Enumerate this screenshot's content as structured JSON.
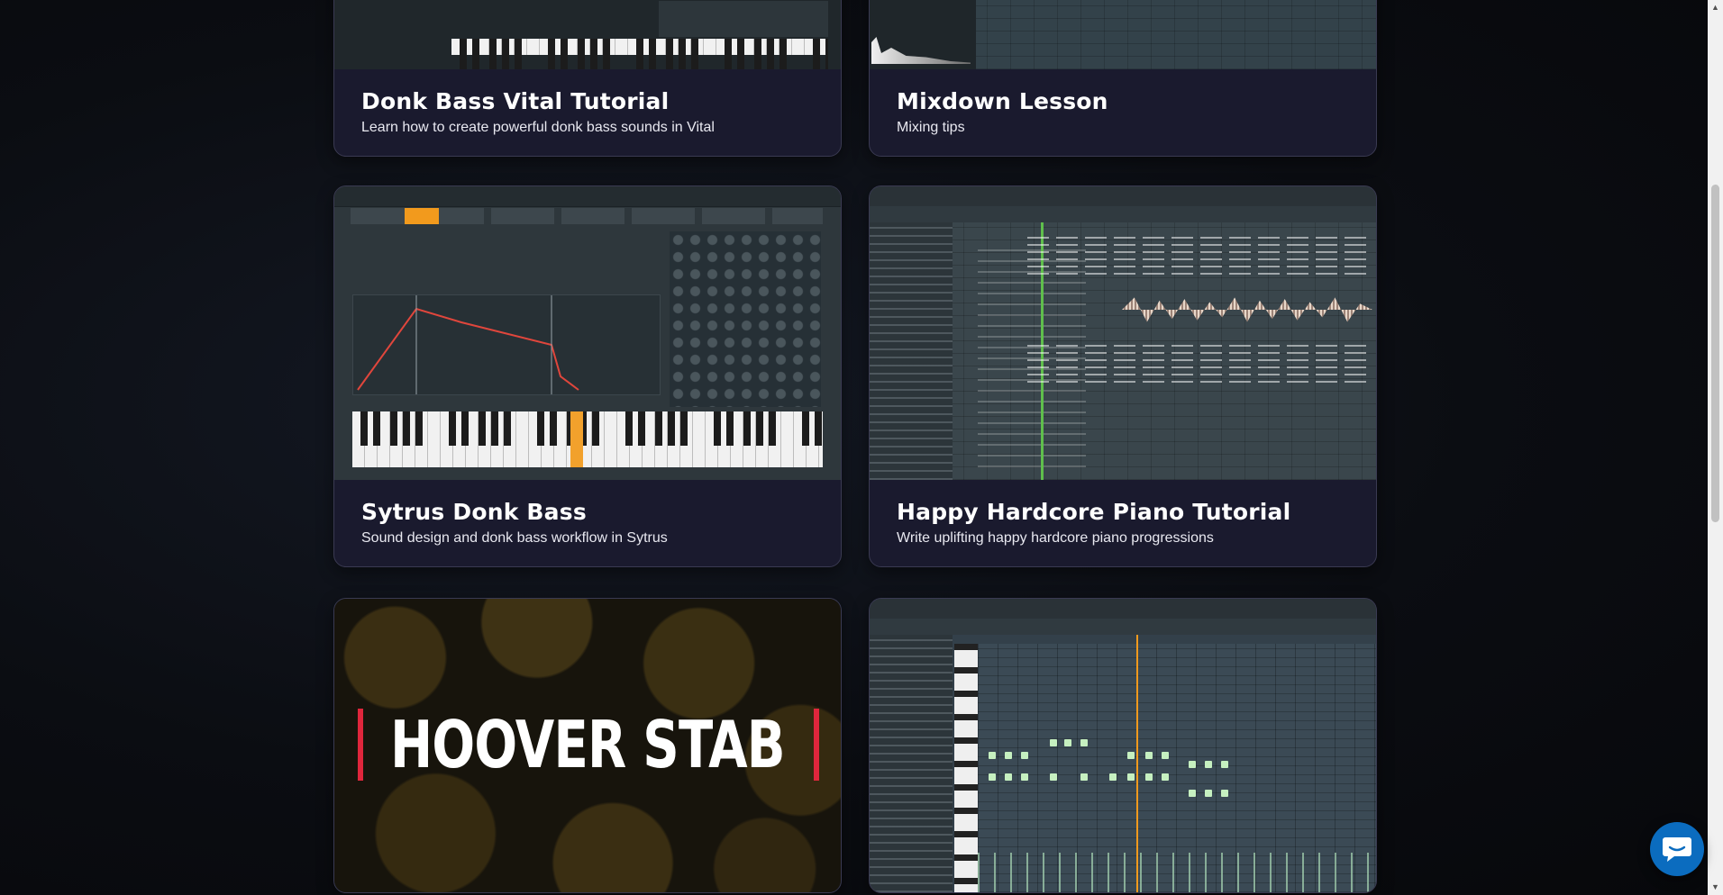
{
  "cards": [
    {
      "title": "Donk Bass Vital Tutorial",
      "subtitle": "Learn how to create powerful donk bass sounds in Vital"
    },
    {
      "title": "Mixdown Lesson",
      "subtitle": "Mixing tips"
    },
    {
      "title": "Sytrus Donk Bass",
      "subtitle": "Sound design and donk bass workflow in Sytrus"
    },
    {
      "title": "Happy Hardcore Piano Tutorial",
      "subtitle": "Write uplifting happy hardcore piano progressions"
    },
    {
      "title": "",
      "subtitle": "",
      "thumbnail_text": "HOOVER STAB"
    },
    {
      "title": "",
      "subtitle": ""
    }
  ],
  "colors": {
    "card_bg": "#1a1a2e",
    "accent_orange": "#f29a1d",
    "hoover_bar_red": "#e0263c",
    "chat_button": "#0b6cbf"
  },
  "icons": {
    "chat_button": "chat-bubble-icon",
    "scroll_up": "triangle-up-icon",
    "scroll_down": "triangle-down-icon"
  }
}
